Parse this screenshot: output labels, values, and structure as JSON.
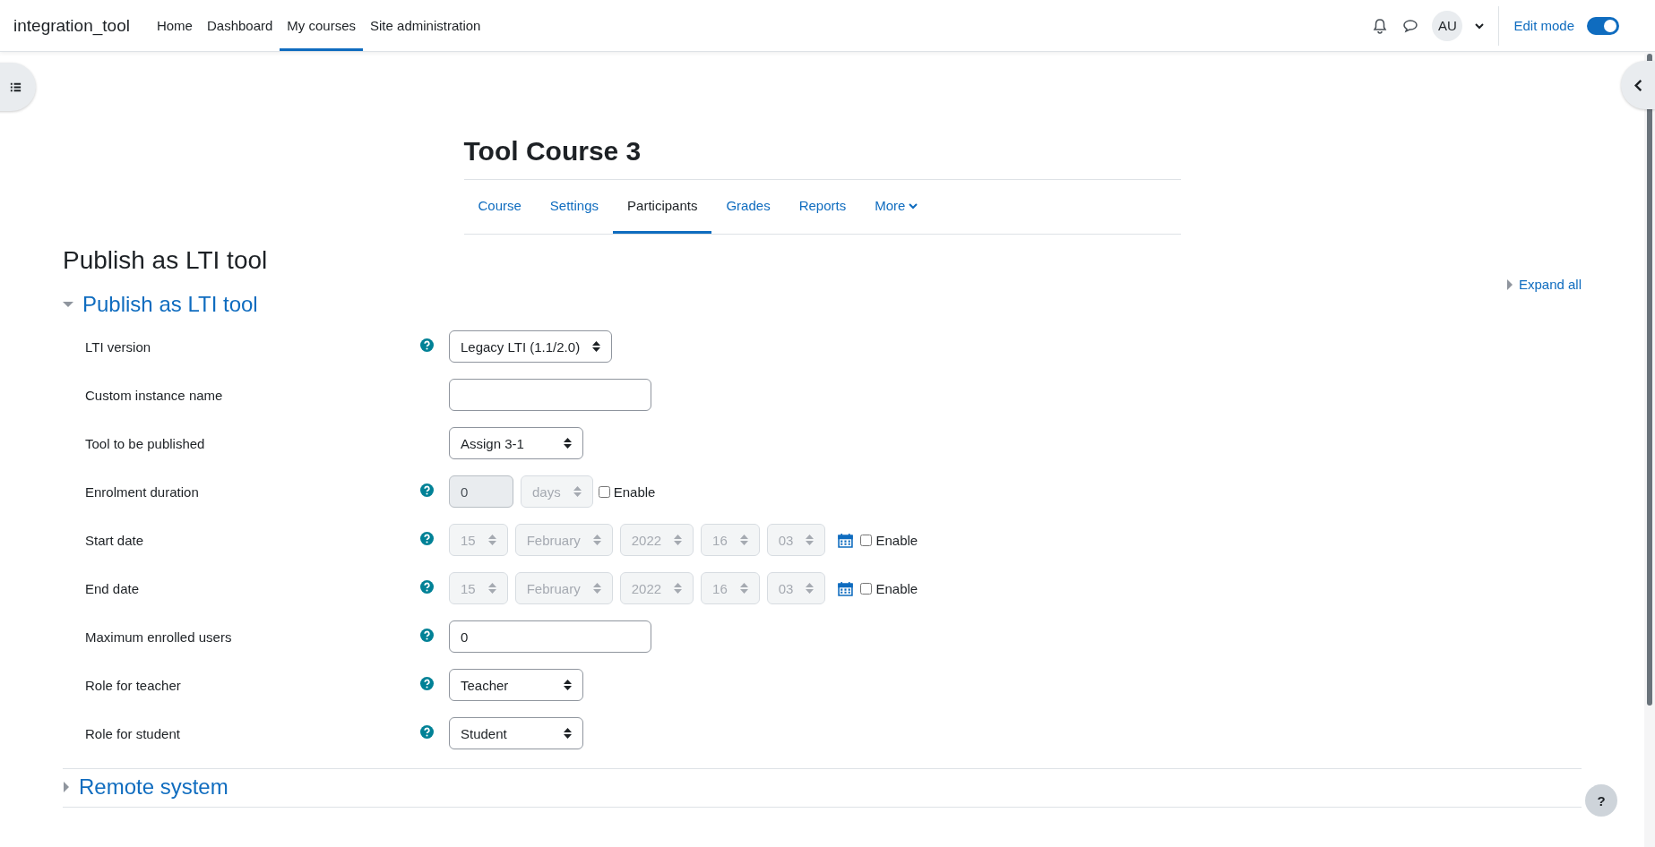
{
  "navbar": {
    "brand": "integration_tool",
    "items": [
      {
        "label": "Home",
        "selected": false
      },
      {
        "label": "Dashboard",
        "selected": false
      },
      {
        "label": "My courses",
        "selected": true
      },
      {
        "label": "Site administration",
        "selected": false
      }
    ],
    "avatar": "AU",
    "edit_mode": {
      "label": "Edit mode",
      "on": true
    }
  },
  "course": {
    "title": "Tool Course 3",
    "tabs": [
      {
        "label": "Course",
        "selected": false
      },
      {
        "label": "Settings",
        "selected": false
      },
      {
        "label": "Participants",
        "selected": true
      },
      {
        "label": "Grades",
        "selected": false
      },
      {
        "label": "Reports",
        "selected": false
      },
      {
        "label": "More",
        "selected": false
      }
    ]
  },
  "page_title": "Publish as LTI tool",
  "expand_all": "Expand all",
  "sections": [
    {
      "title": "Publish as LTI tool",
      "expanded": true,
      "rows": [
        {
          "label": "LTI version",
          "help": true,
          "kind": "select",
          "value": "Legacy LTI (1.1/2.0)"
        },
        {
          "label": "Custom instance name",
          "help": false,
          "kind": "text"
        },
        {
          "label": "Tool to be published",
          "help": false,
          "kind": "select",
          "value": "Assign 3-1"
        },
        {
          "label": "Enrolment duration",
          "help": true,
          "kind": "duration",
          "number": "0",
          "unit": "days",
          "disabled": true,
          "enable": {
            "label": "Enable",
            "checked": false
          }
        },
        {
          "label": "Start date",
          "help": true,
          "kind": "date",
          "parts": [
            "15",
            "February",
            "2022",
            "16",
            "03"
          ],
          "disabled": true,
          "enable": {
            "label": "Enable",
            "checked": false
          }
        },
        {
          "label": "End date",
          "help": true,
          "kind": "date",
          "parts": [
            "15",
            "February",
            "2022",
            "16",
            "03"
          ],
          "disabled": true,
          "enable": {
            "label": "Enable",
            "checked": false
          }
        },
        {
          "label": "Maximum enrolled users",
          "help": true,
          "kind": "text",
          "value": "0"
        },
        {
          "label": "Role for teacher",
          "help": true,
          "kind": "select",
          "value": "Teacher"
        },
        {
          "label": "Role for student",
          "help": true,
          "kind": "select",
          "value": "Student"
        }
      ]
    },
    {
      "title": "Remote system",
      "expanded": false
    }
  ],
  "help_button": "?"
}
